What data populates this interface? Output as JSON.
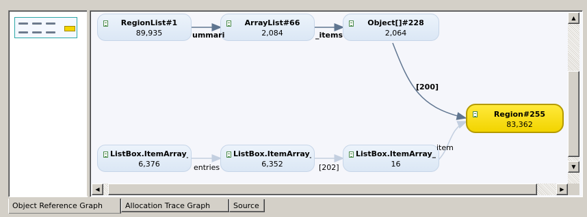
{
  "graph": {
    "nodes": [
      {
        "id": "n1",
        "title": "RegionList#1",
        "value": "89,935"
      },
      {
        "id": "n2",
        "title": "ArrayList#66",
        "value": "2,084"
      },
      {
        "id": "n3",
        "title": "Object[]#228",
        "value": "2,064"
      },
      {
        "id": "n4",
        "title": "Region#255",
        "value": "83,362",
        "selected": true
      },
      {
        "id": "n5",
        "title": "ListBox.ItemArray_",
        "value": "6,376"
      },
      {
        "id": "n6",
        "title": "ListBox.ItemArray_",
        "value": "6,352"
      },
      {
        "id": "n7",
        "title": "ListBox.ItemArray_",
        "value": "16"
      }
    ],
    "edge_labels": {
      "e1": "ummari",
      "e2": "_items",
      "e3": "[200]",
      "e4": "entries",
      "e5": "[202]",
      "e6": "item"
    }
  },
  "tabs": [
    {
      "label": "Object Reference Graph",
      "active": true
    },
    {
      "label": "Allocation Trace Graph",
      "active": false
    },
    {
      "label": "Source",
      "active": false
    }
  ],
  "colors": {
    "selected_node": "#f3d400",
    "node": "#dfe9f6",
    "edge": "#5f7590",
    "edge_faint": "#c8d4e6"
  },
  "icons": {
    "node_icon": "document-icon",
    "scroll_up": "arrow-up-icon",
    "scroll_down": "arrow-down-icon",
    "scroll_left": "arrow-left-icon",
    "scroll_right": "arrow-right-icon"
  }
}
